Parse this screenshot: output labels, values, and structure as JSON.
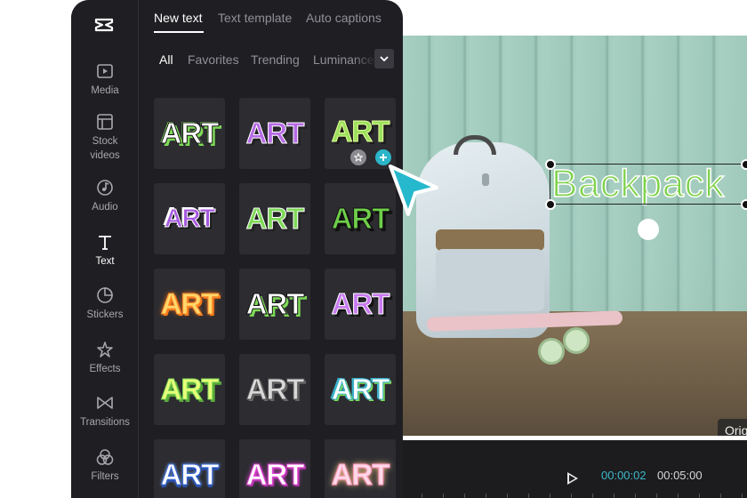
{
  "app": {
    "name": "CapCut"
  },
  "sidebar": {
    "items": [
      {
        "label": "Media",
        "icon": "media-icon",
        "active": false
      },
      {
        "label": "Stock videos",
        "icon": "stock-videos-icon",
        "active": false
      },
      {
        "label": "Audio",
        "icon": "audio-icon",
        "active": false
      },
      {
        "label": "Text",
        "icon": "text-icon",
        "active": true
      },
      {
        "label": "Stickers",
        "icon": "stickers-icon",
        "active": false
      },
      {
        "label": "Effects",
        "icon": "effects-icon",
        "active": false
      },
      {
        "label": "Transitions",
        "icon": "transitions-icon",
        "active": false
      },
      {
        "label": "Filters",
        "icon": "filters-icon",
        "active": false
      }
    ]
  },
  "tabs": [
    {
      "label": "New text",
      "active": true
    },
    {
      "label": "Text template",
      "active": false
    },
    {
      "label": "Auto captions",
      "active": false
    }
  ],
  "categories": [
    {
      "label": "All",
      "active": true
    },
    {
      "label": "Favorites",
      "active": false
    },
    {
      "label": "Trending",
      "active": false
    },
    {
      "label": "Luminance",
      "active": false
    }
  ],
  "text_styles": [
    {
      "text": "ART",
      "style": "white-green-outline"
    },
    {
      "text": "ART",
      "style": "purple-white-outline"
    },
    {
      "text": "ART",
      "style": "lime-dark-shadow"
    },
    {
      "text": "ART",
      "style": "purple-sticker"
    },
    {
      "text": "ART",
      "style": "green-white-outline"
    },
    {
      "text": "ART",
      "style": "green-black-shadow"
    },
    {
      "text": "ART",
      "style": "orange-glow"
    },
    {
      "text": "ART",
      "style": "white-black-green"
    },
    {
      "text": "ART",
      "style": "violet-black-shadow"
    },
    {
      "text": "ART",
      "style": "yellow-green"
    },
    {
      "text": "ART",
      "style": "silver-metallic"
    },
    {
      "text": "ART",
      "style": "white-cyan-green"
    },
    {
      "text": "ART",
      "style": "white-blue-3d"
    },
    {
      "text": "ART",
      "style": "white-magenta-glow"
    },
    {
      "text": "ART",
      "style": "pink-neon-glow"
    }
  ],
  "preview": {
    "overlay_text": "Backpack",
    "ratio_badge": "Orig"
  },
  "player": {
    "current_time": "00:00:02",
    "total_time": "00:05:00"
  },
  "colors": {
    "panel_bg": "#1f1f23",
    "accent": "#2cb5c8",
    "overlay_text": "#7dd24a"
  }
}
